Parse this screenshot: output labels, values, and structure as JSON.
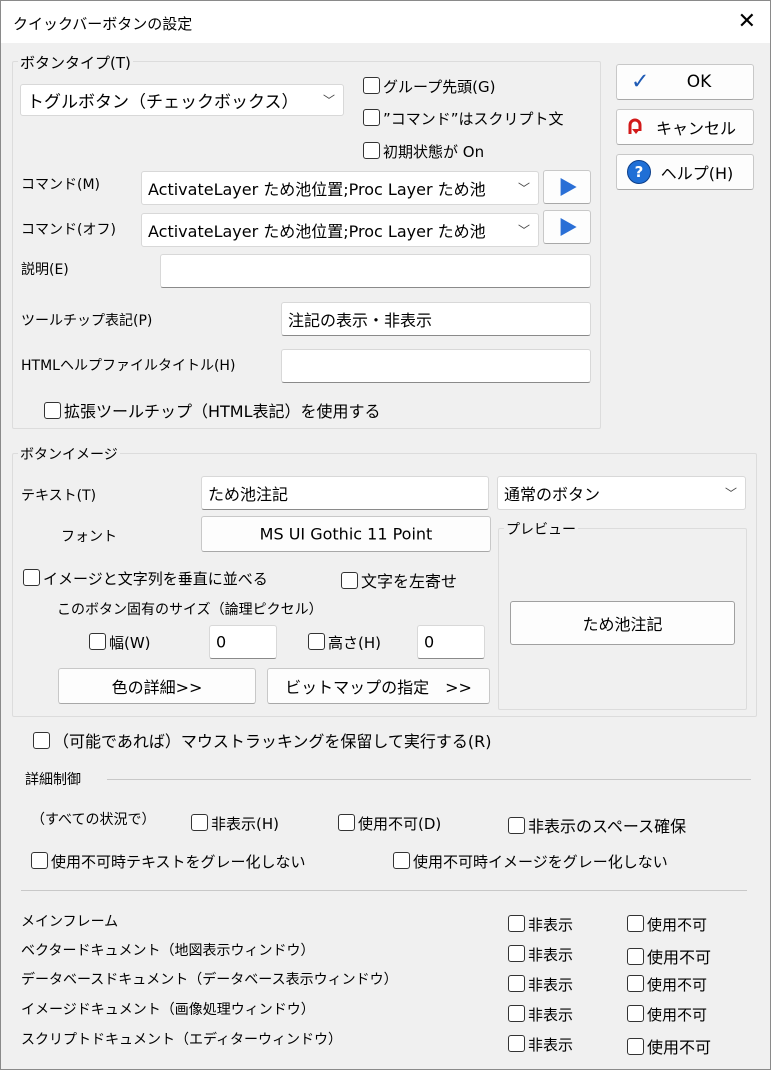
{
  "window": {
    "title": "クイックバーボタンの設定",
    "close_glyph": "✕"
  },
  "button_type": {
    "group_label": "ボタンタイプ(T)",
    "type_value": "トグルボタン（チェックボックス）",
    "group_head": "グループ先頭(G)",
    "command_is_script": "”コマンド”はスクリプト文",
    "initial_on": "初期状態が On",
    "command_label": "コマンド(M)",
    "command_value": "ActivateLayer ため池位置;Proc Layer ため池",
    "command_off_label": "コマンド(オフ)",
    "command_off_value": "ActivateLayer ため池位置;Proc Layer ため池",
    "desc_label": "説明(E)",
    "desc_value": "",
    "tooltip_label": "ツールチップ表記(P)",
    "tooltip_value": "注記の表示・非表示",
    "html_help_label": "HTMLヘルプファイルタイトル(H)",
    "html_help_value": "",
    "extended_tooltip": "拡張ツールチップ（HTML表記）を使用する"
  },
  "dialog_buttons": {
    "ok": "OK",
    "cancel": "キャンセル",
    "help": "ヘルプ(H)"
  },
  "button_image": {
    "group_label": "ボタンイメージ",
    "text_label": "テキスト(T)",
    "text_value": "ため池注記",
    "style_value": "通常のボタン",
    "font_label": "フォント",
    "font_button": "MS UI Gothic 11 Point",
    "preview_label": "プレビュー",
    "preview_button": "ため池注記",
    "vertical_align": "イメージと文字列を垂直に並べる",
    "left_align": "文字を左寄せ",
    "size_caption": "このボタン固有のサイズ（論理ピクセル）",
    "width_label": "幅(W)",
    "width_value": "0",
    "height_label": "高さ(H)",
    "height_value": "0",
    "color_button": "色の詳細>>",
    "bitmap_button": "ビットマップの指定　>>"
  },
  "mouse_tracking": "（可能であれば）マウストラッキングを保留して実行する(R)",
  "detail": {
    "heading": "詳細制御",
    "all_situations": "（すべての状況で）",
    "hidden": "非表示(H)",
    "disabled": "使用不可(D)",
    "reserve_space": "非表示のスペース確保",
    "no_gray_text": "使用不可時テキストをグレー化しない",
    "no_gray_image": "使用不可時イメージをグレー化しない",
    "rows": [
      {
        "label": "メインフレーム",
        "hide": "非表示",
        "disable": "使用不可"
      },
      {
        "label": "ベクタードキュメント（地図表示ウィンドウ）",
        "hide": "非表示",
        "disable": "使用不可"
      },
      {
        "label": "データベースドキュメント（データベース表示ウィンドウ）",
        "hide": "非表示",
        "disable": "使用不可"
      },
      {
        "label": "イメージドキュメント（画像処理ウィンドウ）",
        "hide": "非表示",
        "disable": "使用不可"
      },
      {
        "label": "スクリプトドキュメント（エディターウィンドウ）",
        "hide": "非表示",
        "disable": "使用不可"
      }
    ]
  }
}
